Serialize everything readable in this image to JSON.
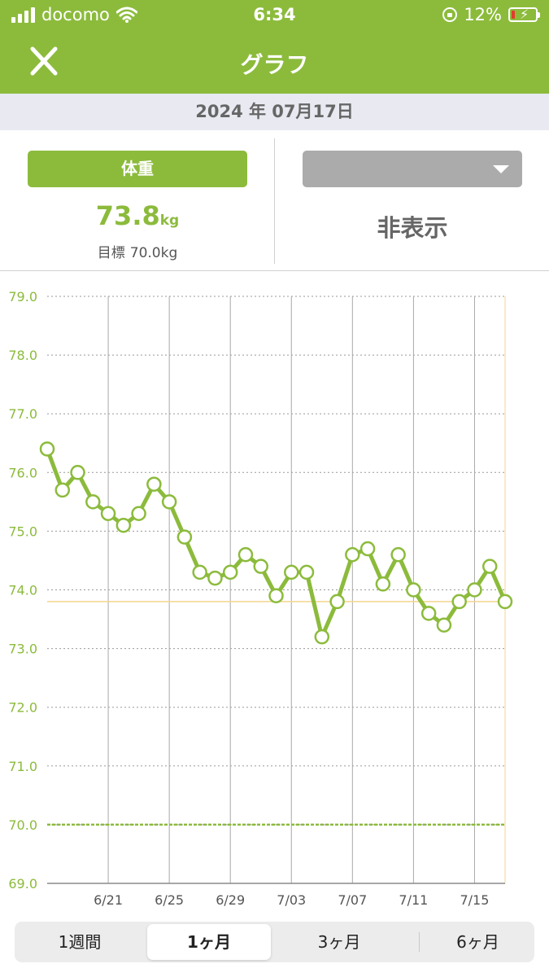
{
  "status_bar": {
    "carrier": "docomo",
    "time": "6:34",
    "battery": "12%"
  },
  "nav": {
    "title": "グラフ"
  },
  "date": "2024 年 07月17日",
  "left_panel": {
    "metric_label": "体重",
    "value": "73.8",
    "unit": "kg",
    "goal_label": "目標",
    "goal_value": "70.0kg"
  },
  "right_panel": {
    "selected": "",
    "state_label": "非表示"
  },
  "chart_data": {
    "type": "line",
    "x_tick_labels": [
      "6/21",
      "6/25",
      "6/29",
      "7/03",
      "7/07",
      "7/11",
      "7/15"
    ],
    "y_tick_labels": [
      "69.0",
      "70.0",
      "71.0",
      "72.0",
      "73.0",
      "74.0",
      "75.0",
      "76.0",
      "77.0",
      "78.0",
      "79.0"
    ],
    "ylim": [
      69.0,
      79.0
    ],
    "xlim": [
      "6/17",
      "7/17"
    ],
    "goal": 70.0,
    "current": 73.8,
    "series": [
      {
        "x": [
          "6/17",
          "6/18",
          "6/19",
          "6/20",
          "6/21",
          "6/22",
          "6/23",
          "6/24",
          "6/25",
          "6/26",
          "6/27",
          "6/28",
          "6/29",
          "6/30",
          "7/01",
          "7/02",
          "7/03",
          "7/04",
          "7/05",
          "7/06",
          "7/07",
          "7/08",
          "7/09",
          "7/10",
          "7/11",
          "7/12",
          "7/13",
          "7/14",
          "7/15",
          "7/16",
          "7/17"
        ],
        "values": [
          76.4,
          75.7,
          76.0,
          75.5,
          75.3,
          75.1,
          75.3,
          75.8,
          75.5,
          74.9,
          74.3,
          74.2,
          74.3,
          74.6,
          74.4,
          73.9,
          74.3,
          74.3,
          73.2,
          73.8,
          74.6,
          74.7,
          74.1,
          74.6,
          74.0,
          73.6,
          73.4,
          73.8,
          74.0,
          74.4,
          73.8
        ]
      }
    ],
    "colors": {
      "line": "#8cbb3c",
      "goal": "#8cbb3c",
      "current": "#f4d58f",
      "axis_text": "#8cbb3c",
      "x_text": "#555555"
    }
  },
  "segments": [
    "1週間",
    "1ヶ月",
    "3ヶ月",
    "6ヶ月"
  ],
  "active_segment": "1ヶ月"
}
